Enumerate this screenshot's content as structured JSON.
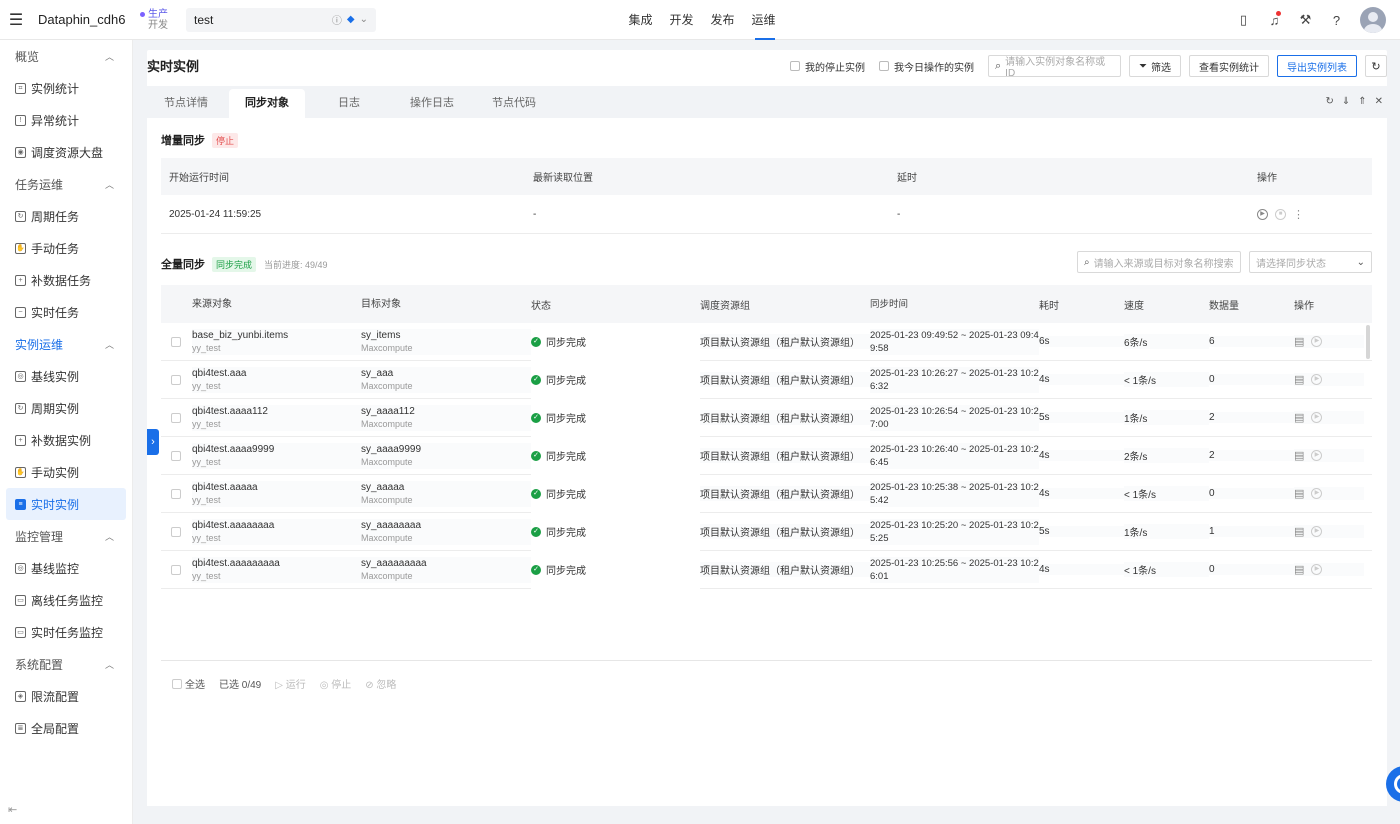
{
  "topbar": {
    "app_name": "Dataphin_cdh6",
    "env_prod": "生产",
    "env_dev": "开发",
    "project": "test",
    "nav": [
      "集成",
      "开发",
      "发布",
      "运维"
    ],
    "active_nav": "运维"
  },
  "sidebar": {
    "groups": [
      {
        "label": "概览",
        "items": [
          "实例统计",
          "异常统计",
          "调度资源大盘"
        ]
      },
      {
        "label": "任务运维",
        "items": [
          "周期任务",
          "手动任务",
          "补数据任务",
          "实时任务"
        ]
      },
      {
        "label": "实例运维",
        "items": [
          "基线实例",
          "周期实例",
          "补数据实例",
          "手动实例",
          "实时实例"
        ]
      },
      {
        "label": "监控管理",
        "items": [
          "基线监控",
          "离线任务监控",
          "实时任务监控"
        ]
      },
      {
        "label": "系统配置",
        "items": [
          "限流配置",
          "全局配置"
        ]
      }
    ],
    "active_item": "实时实例"
  },
  "header": {
    "title": "实时实例",
    "chk_stopped": "我的停止实例",
    "chk_today": "我今日操作的实例",
    "search_placeholder": "请输入实例对象名称或ID",
    "filter_label": "筛选",
    "stats_label": "查看实例统计",
    "export_label": "导出实例列表"
  },
  "tabs": [
    "节点详情",
    "同步对象",
    "日志",
    "操作日志",
    "节点代码"
  ],
  "active_tab": "同步对象",
  "incremental": {
    "title": "增量同步",
    "status": "停止",
    "columns": [
      "开始运行时间",
      "最新读取位置",
      "延时",
      "操作"
    ],
    "row": {
      "start_time": "2025-01-24 11:59:25",
      "position": "-",
      "delay": "-"
    }
  },
  "full": {
    "title": "全量同步",
    "status": "同步完成",
    "progress": "当前进度: 49/49",
    "search_placeholder": "请输入来源或目标对象名称搜索",
    "select_placeholder": "请选择同步状态",
    "columns": [
      "来源对象",
      "目标对象",
      "状态",
      "调度资源组",
      "同步时间",
      "耗时",
      "速度",
      "数据量",
      "操作"
    ],
    "rows": [
      {
        "src": "base_biz_yunbi.items",
        "src_sub": "yy_test",
        "tgt": "sy_items",
        "tgt_sub": "Maxcompute",
        "status": "同步完成",
        "group": "项目默认资源组（租户默认资源组）",
        "time1": "2025-01-23 09:49:52 ~ 2025-01-23 09:4",
        "time2": "9:58",
        "dur": "6s",
        "speed": "6条/s",
        "count": "6"
      },
      {
        "src": "qbi4test.aaa",
        "src_sub": "yy_test",
        "tgt": "sy_aaa",
        "tgt_sub": "Maxcompute",
        "status": "同步完成",
        "group": "项目默认资源组（租户默认资源组）",
        "time1": "2025-01-23 10:26:27 ~ 2025-01-23 10:2",
        "time2": "6:32",
        "dur": "4s",
        "speed": "< 1条/s",
        "count": "0"
      },
      {
        "src": "qbi4test.aaaa112",
        "src_sub": "yy_test",
        "tgt": "sy_aaaa112",
        "tgt_sub": "Maxcompute",
        "status": "同步完成",
        "group": "项目默认资源组（租户默认资源组）",
        "time1": "2025-01-23 10:26:54 ~ 2025-01-23 10:2",
        "time2": "7:00",
        "dur": "5s",
        "speed": "1条/s",
        "count": "2"
      },
      {
        "src": "qbi4test.aaaa9999",
        "src_sub": "yy_test",
        "tgt": "sy_aaaa9999",
        "tgt_sub": "Maxcompute",
        "status": "同步完成",
        "group": "项目默认资源组（租户默认资源组）",
        "time1": "2025-01-23 10:26:40 ~ 2025-01-23 10:2",
        "time2": "6:45",
        "dur": "4s",
        "speed": "2条/s",
        "count": "2"
      },
      {
        "src": "qbi4test.aaaaa",
        "src_sub": "yy_test",
        "tgt": "sy_aaaaa",
        "tgt_sub": "Maxcompute",
        "status": "同步完成",
        "group": "项目默认资源组（租户默认资源组）",
        "time1": "2025-01-23 10:25:38 ~ 2025-01-23 10:2",
        "time2": "5:42",
        "dur": "4s",
        "speed": "< 1条/s",
        "count": "0"
      },
      {
        "src": "qbi4test.aaaaaaaa",
        "src_sub": "yy_test",
        "tgt": "sy_aaaaaaaa",
        "tgt_sub": "Maxcompute",
        "status": "同步完成",
        "group": "项目默认资源组（租户默认资源组）",
        "time1": "2025-01-23 10:25:20 ~ 2025-01-23 10:2",
        "time2": "5:25",
        "dur": "5s",
        "speed": "1条/s",
        "count": "1"
      },
      {
        "src": "qbi4test.aaaaaaaaa",
        "src_sub": "yy_test",
        "tgt": "sy_aaaaaaaaa",
        "tgt_sub": "Maxcompute",
        "status": "同步完成",
        "group": "项目默认资源组（租户默认资源组）",
        "time1": "2025-01-23 10:25:56 ~ 2025-01-23 10:2",
        "time2": "6:01",
        "dur": "4s",
        "speed": "< 1条/s",
        "count": "0"
      }
    ],
    "footer": {
      "select_all": "全选",
      "selected": "已选 0/49",
      "run": "运行",
      "stop": "停止",
      "ignore": "忽略"
    }
  }
}
